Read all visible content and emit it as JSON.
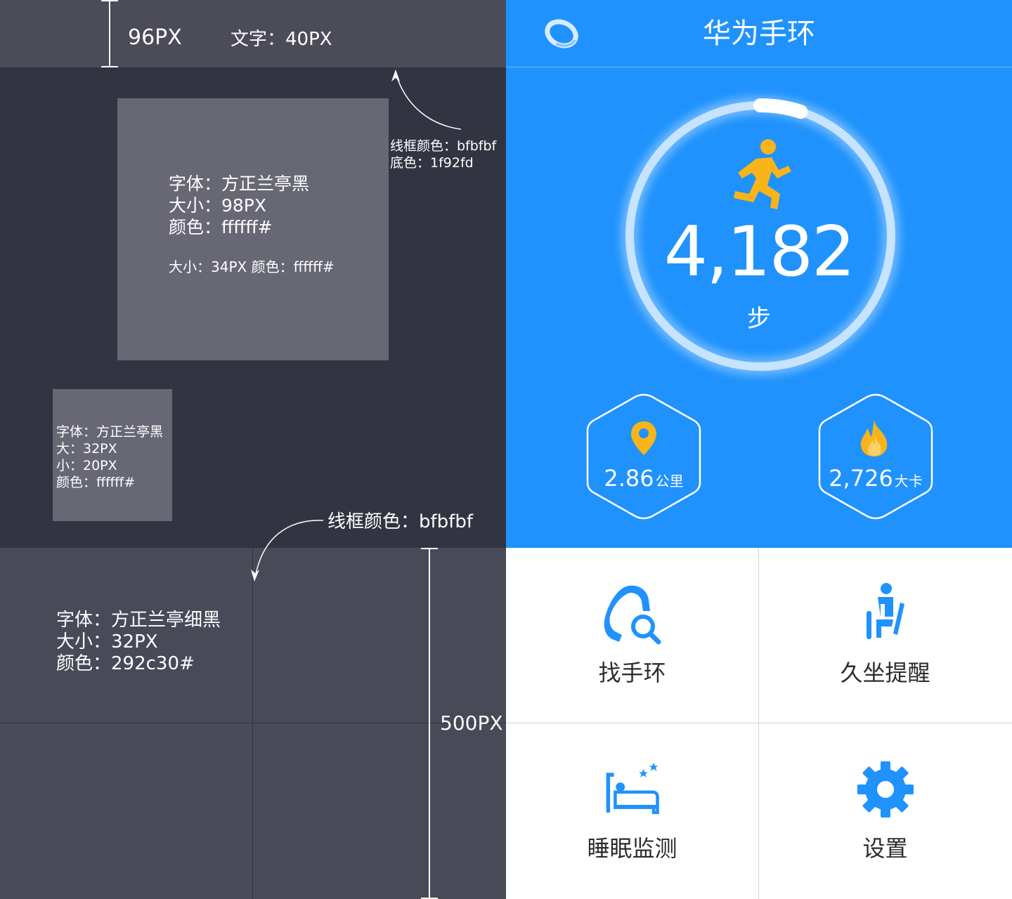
{
  "spec": {
    "header_height_label": "96PX",
    "header_text_size": "文字：40PX",
    "header_note_border": "线框颜色：bfbfbf",
    "header_note_bg": "底色：1f92fd",
    "big_box": {
      "font": "字体：方正兰亭黑",
      "size": "大小：98PX",
      "color": "颜色：ffffff#",
      "sub": "大小：34PX  颜色：ffffff#"
    },
    "small_box": {
      "font": "字体：方正兰亭黑",
      "big": "大：32PX",
      "small": "小：20PX",
      "color": "颜色：ffffff#"
    },
    "grid_note_border": "线框颜色：bfbfbf",
    "grid_text": {
      "font": "字体：方正兰亭细黑",
      "size": "大小：32PX",
      "color": "颜色：292c30#"
    },
    "grid_height_label": "500PX"
  },
  "app": {
    "title": "华为手环",
    "logo_icon": "band-logo-icon",
    "steps": {
      "value": "4,182",
      "unit": "步",
      "progress": 0.05
    },
    "distance": {
      "value": "2.86",
      "unit": "公里",
      "icon": "location-pin-icon"
    },
    "calories": {
      "value": "2,726",
      "unit": "大卡",
      "icon": "flame-icon"
    },
    "menu": [
      {
        "label": "找手环",
        "icon": "find-band-icon"
      },
      {
        "label": "久坐提醒",
        "icon": "sedentary-reminder-icon"
      },
      {
        "label": "睡眠监测",
        "icon": "sleep-monitor-icon"
      },
      {
        "label": "设置",
        "icon": "gear-icon"
      }
    ]
  },
  "colors": {
    "brand_blue": "#1f92fd",
    "accent_yellow": "#f8b418",
    "text_dark": "#292c30",
    "border": "#bfbfbf",
    "spec_bg": "#323441"
  }
}
